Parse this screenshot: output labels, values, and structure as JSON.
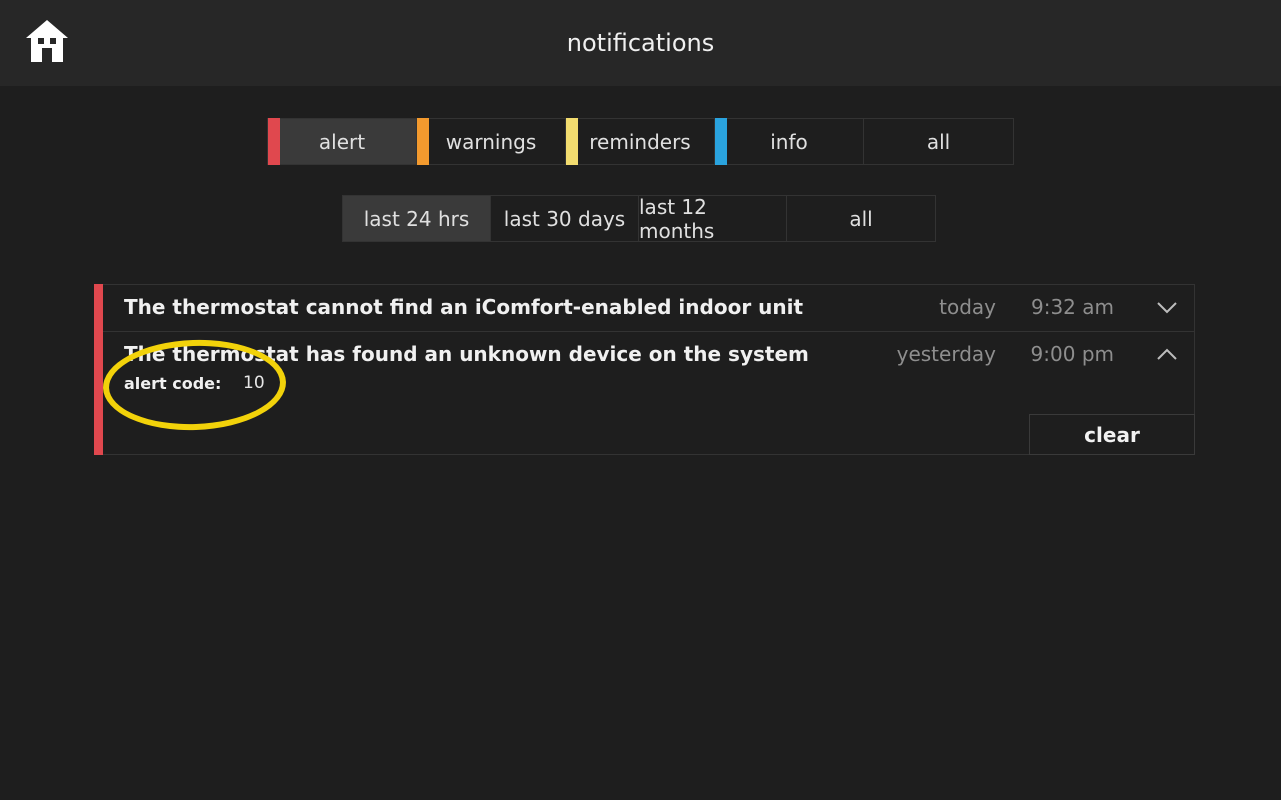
{
  "header": {
    "title": "notifications",
    "home_icon": "home-icon"
  },
  "type_filters": [
    {
      "label": "alert",
      "color": "#e0484e",
      "selected": true
    },
    {
      "label": "warnings",
      "color": "#f39a2e",
      "selected": false
    },
    {
      "label": "reminders",
      "color": "#f2dc6f",
      "selected": false
    },
    {
      "label": "info",
      "color": "#2aa3de",
      "selected": false
    },
    {
      "label": "all",
      "color": "",
      "selected": false
    }
  ],
  "time_filters": [
    {
      "label": "last 24 hrs",
      "selected": true
    },
    {
      "label": "last 30 days",
      "selected": false
    },
    {
      "label": "last 12 months",
      "selected": false
    },
    {
      "label": "all",
      "selected": false
    }
  ],
  "notifications": [
    {
      "message": "The thermostat cannot find an iComfort-enabled indoor unit",
      "day": "today",
      "time": "9:32 am",
      "expanded": false,
      "chevron_icon": "chevron-down-icon"
    },
    {
      "message": "The thermostat has found an unknown device on the system",
      "day": "yesterday",
      "time": "9:00 pm",
      "expanded": true,
      "chevron_icon": "chevron-up-icon",
      "code_label": "alert code:",
      "code_value": "10",
      "clear_label": "clear"
    }
  ],
  "colors": {
    "alert": "#e0484e",
    "highlight": "#f2d20a"
  }
}
